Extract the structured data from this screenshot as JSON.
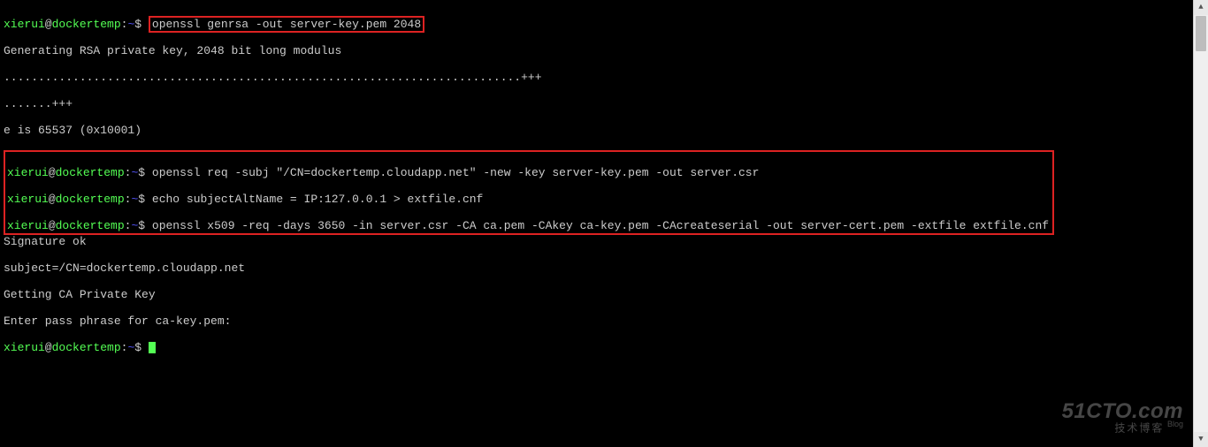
{
  "prompt": {
    "user": "xierui",
    "host": "dockertemp",
    "path": "~",
    "symbol": "$"
  },
  "lines": {
    "cmd1": "openssl genrsa -out server-key.pem 2048",
    "out1": "Generating RSA private key, 2048 bit long modulus",
    "out2": "...........................................................................+++",
    "out3": ".......+++",
    "out4": "e is 65537 (0x10001)",
    "cmd2": "openssl req -subj \"/CN=dockertemp.cloudapp.net\" -new -key server-key.pem -out server.csr",
    "cmd3": "echo subjectAltName = IP:127.0.0.1 > extfile.cnf",
    "cmd4": "openssl x509 -req -days 3650 -in server.csr -CA ca.pem -CAkey ca-key.pem -CAcreateserial -out server-cert.pem -extfile extfile.cnf",
    "out5": "Signature ok",
    "out6": "subject=/CN=dockertemp.cloudapp.net",
    "out7": "Getting CA Private Key",
    "out8": "Enter pass phrase for ca-key.pem:"
  },
  "watermark": {
    "big": "51CTO.com",
    "small": "技术博客",
    "tag": "Blog"
  },
  "scrollbar": {
    "up_glyph": "▲",
    "down_glyph": "▼"
  }
}
